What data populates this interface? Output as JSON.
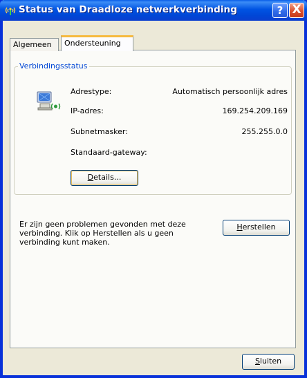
{
  "window": {
    "title": "Status van Draadloze netwerkverbinding",
    "help_symbol": "?",
    "close_symbol": "X"
  },
  "tabs": [
    {
      "label": "Algemeen",
      "selected": false
    },
    {
      "label": "Ondersteuning",
      "selected": true
    }
  ],
  "connection_status": {
    "group_title": "Verbindingsstatus",
    "rows": [
      {
        "label": "Adrestype:",
        "value": "Automatisch persoonlijk adres"
      },
      {
        "label": "IP-adres:",
        "value": "169.254.209.169"
      },
      {
        "label": "Subnetmasker:",
        "value": "255.255.0.0"
      },
      {
        "label": "Standaard-gateway:",
        "value": ""
      }
    ],
    "details_button": "Details..."
  },
  "message": {
    "text": "Er zijn geen problemen gevonden met deze verbinding. Klik op Herstellen als u geen verbinding kunt maken."
  },
  "buttons": {
    "repair": "Herstellen",
    "close": "Sluiten"
  },
  "colors": {
    "titlebar": "#0054e3",
    "group_title": "#0046d5",
    "tab_highlight": "#f6b93d",
    "dialog_bg": "#ece9d8"
  }
}
